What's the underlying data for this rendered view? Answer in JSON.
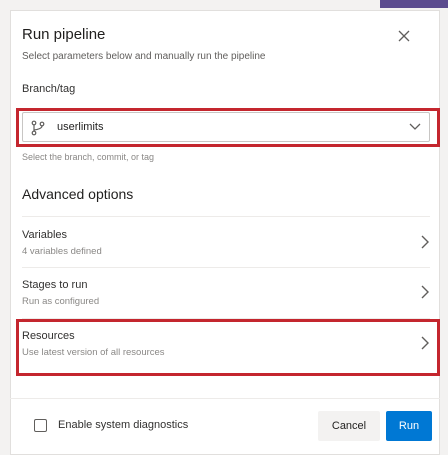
{
  "dialog": {
    "title": "Run pipeline",
    "subtitle": "Select parameters below and manually run the pipeline"
  },
  "branch": {
    "label": "Branch/tag",
    "value": "userlimits",
    "help": "Select the branch, commit, or tag"
  },
  "advanced": {
    "title": "Advanced options",
    "items": [
      {
        "title": "Variables",
        "subtitle": "4 variables defined"
      },
      {
        "title": "Stages to run",
        "subtitle": "Run as configured"
      },
      {
        "title": "Resources",
        "subtitle": "Use latest version of all resources"
      }
    ]
  },
  "footer": {
    "checkbox_label": "Enable system diagnostics",
    "cancel_label": "Cancel",
    "run_label": "Run"
  },
  "colors": {
    "primary": "#0078d4",
    "highlight": "#c4262e"
  },
  "icons": {
    "close": "close-icon",
    "branch": "branch-icon",
    "chevron_down": "chevron-down-icon",
    "chevron_right": "chevron-right-icon"
  }
}
